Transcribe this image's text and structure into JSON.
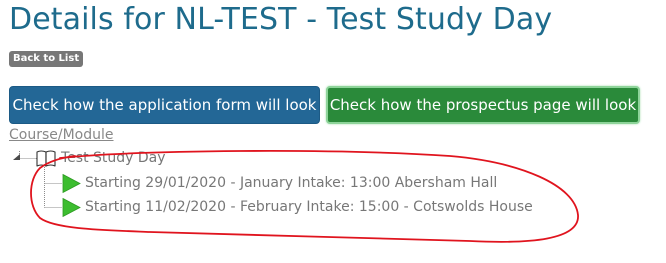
{
  "header": {
    "title": "Details for NL-TEST - Test Study Day"
  },
  "nav": {
    "back_label": "Back to List"
  },
  "actions": {
    "form_button_label": "Check how the application form will look",
    "prospectus_button_label": "Check how the prospectus page will look"
  },
  "tree": {
    "section_label": "Course/Module",
    "course": {
      "label": "Test Study Day",
      "icon": "book-icon"
    },
    "sessions": [
      {
        "label": "Starting 29/01/2020 - January Intake: 13:00 Abersham Hall",
        "icon": "play-icon"
      },
      {
        "label": "Starting 11/02/2020 - February Intake: 15:00 - Cotswolds House",
        "icon": "play-icon"
      }
    ]
  },
  "colors": {
    "title": "#1e6b8c",
    "form_button": "#236796",
    "prospectus_button": "#2a8a3a",
    "play_icon": "#3cbd2f",
    "annotation": "#e0141e"
  }
}
